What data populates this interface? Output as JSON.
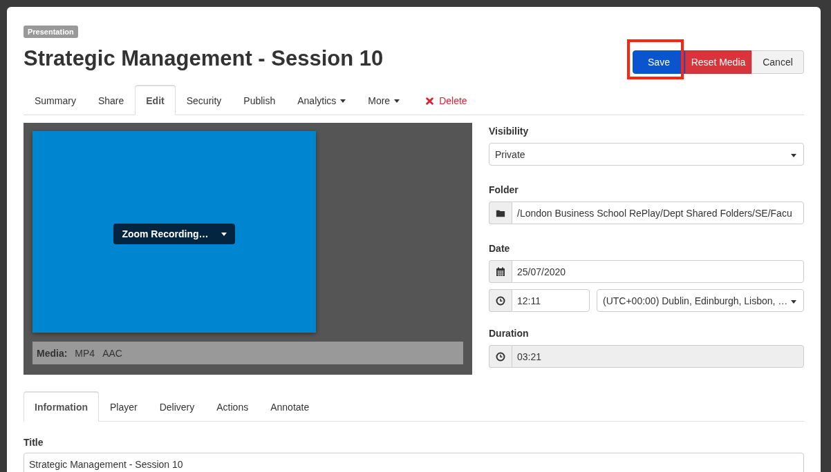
{
  "badge": "Presentation",
  "title": "Strategic Management - Session 10",
  "header_buttons": [
    {
      "label": "Save",
      "kind": "primary",
      "highlighted": true
    },
    {
      "label": "Reset Media",
      "kind": "danger",
      "highlighted": false
    },
    {
      "label": "Cancel",
      "kind": "default",
      "highlighted": false
    }
  ],
  "tabs": [
    {
      "label": "Summary",
      "selected": false,
      "dropdown": false,
      "kind": "tab"
    },
    {
      "label": "Share",
      "selected": false,
      "dropdown": false,
      "kind": "tab"
    },
    {
      "label": "Edit",
      "selected": true,
      "dropdown": false,
      "kind": "tab"
    },
    {
      "label": "Security",
      "selected": false,
      "dropdown": false,
      "kind": "tab"
    },
    {
      "label": "Publish",
      "selected": false,
      "dropdown": false,
      "kind": "tab"
    },
    {
      "label": "Analytics",
      "selected": false,
      "dropdown": true,
      "kind": "tab"
    },
    {
      "label": "More",
      "selected": false,
      "dropdown": true,
      "kind": "tab"
    },
    {
      "label": "Delete",
      "kind": "delete"
    }
  ],
  "preview": {
    "menu_label": "Zoom Recording…",
    "media_label": "Media:",
    "formats": [
      "MP4",
      "AAC"
    ]
  },
  "visibility": {
    "label": "Visibility",
    "value": "Private"
  },
  "folder": {
    "label": "Folder",
    "value": "/London Business School RePlay/Dept Shared Folders/SE/Facu"
  },
  "date": {
    "label": "Date",
    "value": "25/07/2020",
    "time": "12:11",
    "timezone": "(UTC+00:00) Dublin, Edinburgh, Lisbon, …"
  },
  "duration": {
    "label": "Duration",
    "value": "03:21",
    "disabled": true
  },
  "sub_tabs": [
    {
      "label": "Information",
      "selected": true
    },
    {
      "label": "Player",
      "selected": false
    },
    {
      "label": "Delivery",
      "selected": false
    },
    {
      "label": "Actions",
      "selected": false
    },
    {
      "label": "Annotate",
      "selected": false
    }
  ],
  "title_field": {
    "label": "Title",
    "value": "Strategic Management - Session 10"
  }
}
